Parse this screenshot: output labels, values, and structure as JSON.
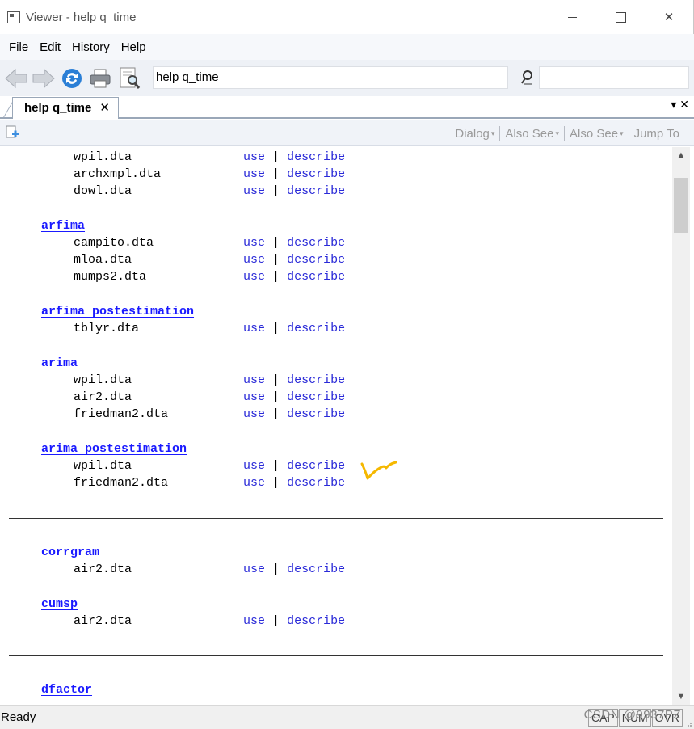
{
  "window": {
    "title": "Viewer - help q_time",
    "close_glyph": "✕"
  },
  "menu": [
    "File",
    "Edit",
    "History",
    "Help"
  ],
  "toolbar": {
    "command_value": "help q_time",
    "find_value": ""
  },
  "tab": {
    "label": "help q_time",
    "close_glyph": "✕",
    "controls_glyph": "▾ ✕"
  },
  "secondary_bar": {
    "links": [
      "Dialog",
      "Also See",
      "Also See",
      "Jump To"
    ]
  },
  "content": {
    "use_label": "use",
    "separator": "|",
    "describe_label": "describe",
    "groups": [
      {
        "heading": "",
        "files": [
          "wpil.dta",
          "archxmpl.dta",
          "dowl.dta"
        ]
      },
      {
        "heading": "arfima",
        "files": [
          "campito.dta",
          "mloa.dta",
          "mumps2.dta"
        ]
      },
      {
        "heading": "arfima postestimation",
        "files": [
          "tblyr.dta"
        ]
      },
      {
        "heading": "arima",
        "files": [
          "wpil.dta",
          "air2.dta",
          "friedman2.dta"
        ]
      },
      {
        "heading": "arima postestimation",
        "files": [
          "wpil.dta",
          "friedman2.dta"
        ]
      },
      {
        "heading": "corrgram",
        "files": [
          "air2.dta"
        ]
      },
      {
        "heading": "cumsp",
        "files": [
          "air2.dta"
        ]
      },
      {
        "heading": "dfactor",
        "files": []
      }
    ]
  },
  "status": {
    "text": "Ready",
    "panels": [
      "CAP",
      "NUM",
      "OVR"
    ],
    "watermark": "CSDN @9937PZ"
  },
  "colors": {
    "link": "#2a2ad8",
    "heading_link": "#1a1aff",
    "annotation": "#f5b800"
  }
}
